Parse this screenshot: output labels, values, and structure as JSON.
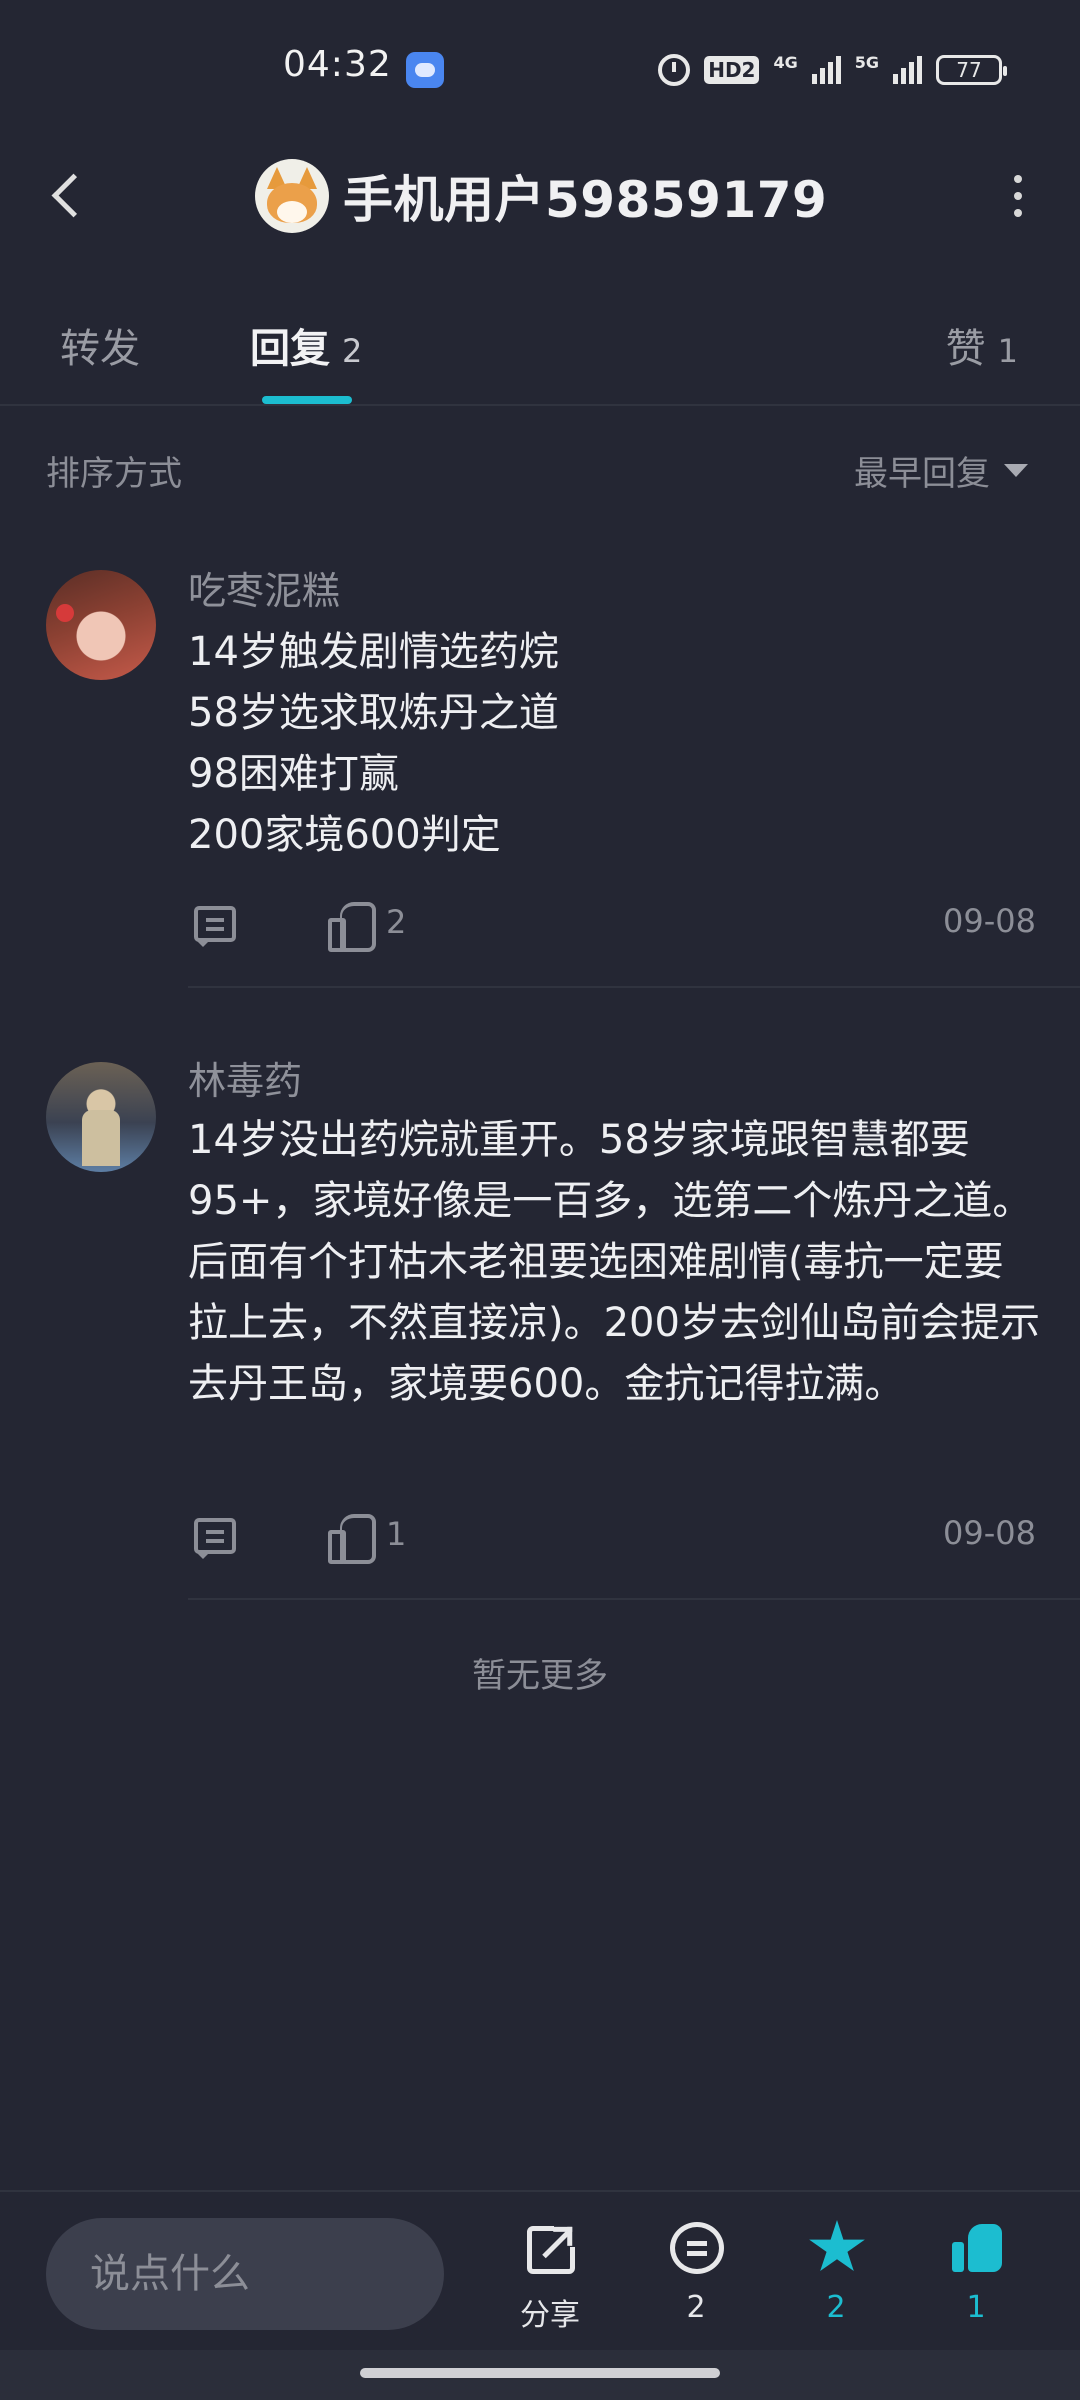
{
  "status_bar": {
    "time": "04:32",
    "hd_label": "HD2",
    "network_1": "4G",
    "network_2": "5G",
    "battery": "77"
  },
  "header": {
    "title": "手机用户59859179",
    "back_icon": "chevron-left-icon",
    "more_icon": "more-vertical-icon"
  },
  "tabs": {
    "forward": {
      "label": "转发"
    },
    "reply": {
      "label": "回复",
      "count": "2"
    },
    "like": {
      "label": "赞",
      "count": "1"
    },
    "active": "reply",
    "accent_color": "#1cbdd0"
  },
  "sort": {
    "label": "排序方式",
    "value": "最早回复"
  },
  "comments": [
    {
      "username": "吃枣泥糕",
      "body": "14岁触发剧情选药烷\n58岁选求取炼丹之道\n98困难打赢\n200家境600判定",
      "likes": "2",
      "date": "09-08"
    },
    {
      "username": "林毒药",
      "body": "14岁没出药烷就重开。58岁家境跟智慧都要95+，家境好像是一百多，选第二个炼丹之道。后面有个打枯木老祖要选困难剧情(毒抗一定要拉上去，不然直接凉)。200岁去剑仙岛前会提示去丹王岛，家境要600。金抗记得拉满。",
      "likes": "1",
      "date": "09-08"
    }
  ],
  "footer_text": "暂无更多",
  "bottom_bar": {
    "input_placeholder": "说点什么",
    "share_label": "分享",
    "comment_count": "2",
    "favorite_count": "2",
    "like_count": "1"
  }
}
